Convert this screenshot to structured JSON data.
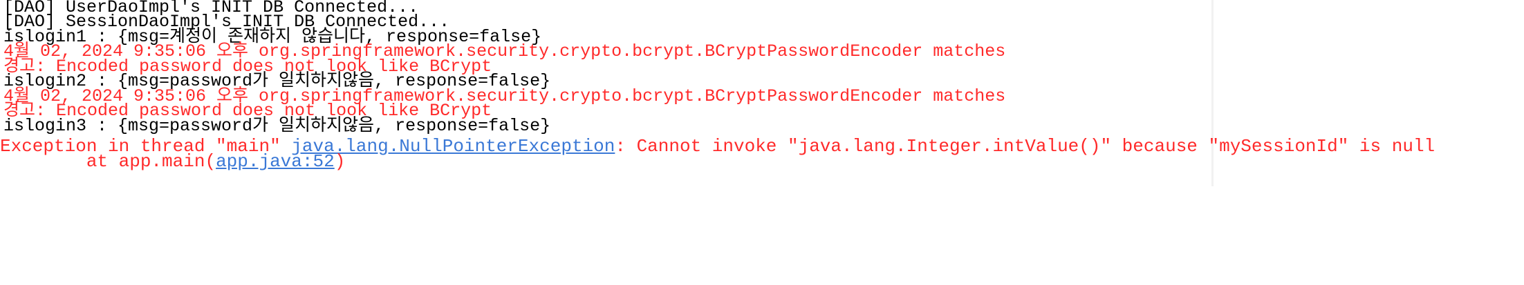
{
  "colors": {
    "stdout": "#000000",
    "stderr": "#ff2a2a",
    "link": "#3a78d6",
    "background": "#ffffff"
  },
  "console": {
    "lines": [
      "[DAO] UserDaoImpl's INIT DB Connected...",
      "[DAO] SessionDaoImpl's INIT DB Connected...",
      "islogin1 : {msg=계정이 존재하지 않습니다, response=false}",
      "4월 02, 2024 9:35:06 오후 org.springframework.security.crypto.bcrypt.BCryptPasswordEncoder matches",
      "경고: Encoded password does not look like BCrypt",
      "islogin2 : {msg=password가 일치하지않음, response=false}",
      "4월 02, 2024 9:35:06 오후 org.springframework.security.crypto.bcrypt.BCryptPasswordEncoder matches",
      "경고: Encoded password does not look like BCrypt",
      "islogin3 : {msg=password가 일치하지않음, response=false}"
    ],
    "exception": {
      "prefix": "Exception in thread \"main\" ",
      "link": "java.lang.NullPointerException",
      "message": ": Cannot invoke \"java.lang.Integer.intValue()\" because \"mySessionId\" is null",
      "trace_prefix": "        at app.main(",
      "trace_link": "app.java:52",
      "trace_suffix": ")"
    }
  }
}
